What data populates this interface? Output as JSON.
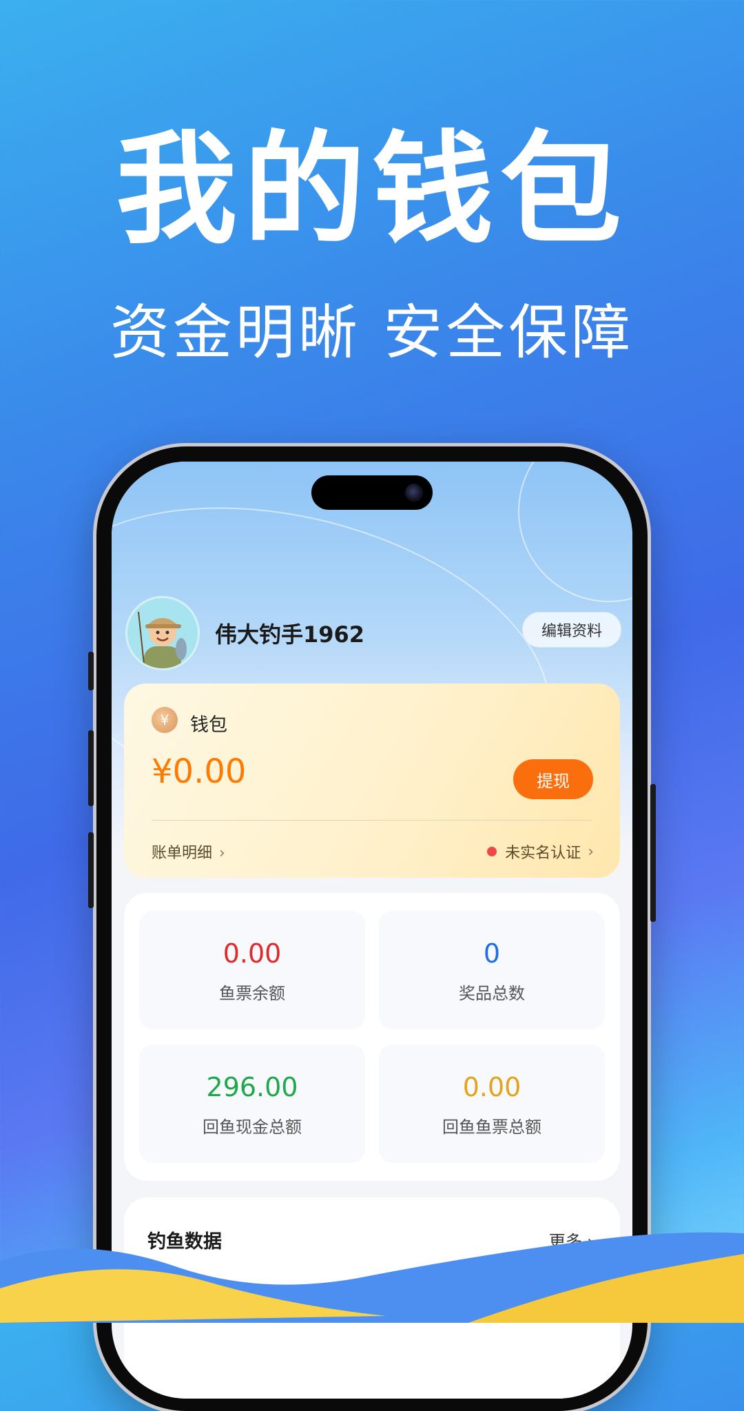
{
  "headline": {
    "title": "我的钱包",
    "subtitle": "资金明晰 安全保障"
  },
  "profile": {
    "username": "伟大钓手1962",
    "edit_label": "编辑资料"
  },
  "wallet": {
    "label": "钱包",
    "coin_symbol": "¥",
    "balance": "¥0.00",
    "withdraw_label": "提现",
    "bill_label": "账单明细",
    "bill_chevron": "›",
    "verify_label": "未实名认证",
    "verify_chevron": "›"
  },
  "stats": [
    {
      "value": "0.00",
      "label": "鱼票余额",
      "color": "#e02a2a"
    },
    {
      "value": "0",
      "label": "奖品总数",
      "color": "#1e6fe0"
    },
    {
      "value": "296.00",
      "label": "回鱼现金总额",
      "color": "#1fa84a"
    },
    {
      "value": "0.00",
      "label": "回鱼鱼票总额",
      "color": "#e5a21c"
    }
  ],
  "fishing_data": {
    "title": "钓鱼数据",
    "more_label": "更多 ›"
  },
  "colors": {
    "accent_orange": "#fb6e0e",
    "balance_orange": "#ff7a00",
    "alert_red": "#f14646"
  }
}
